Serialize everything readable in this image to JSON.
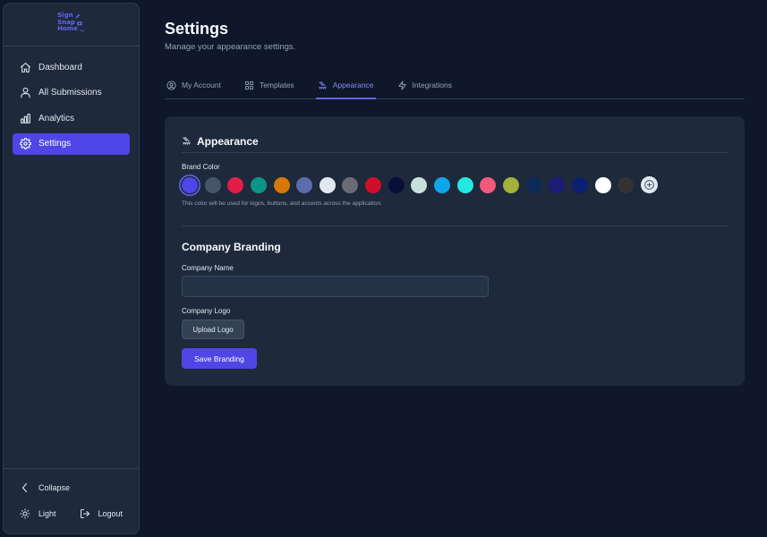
{
  "logo": {
    "line1": "Sign",
    "line2": "Snap",
    "line3": "Home"
  },
  "sidebar": {
    "items": [
      {
        "label": "Dashboard",
        "icon": "home-icon"
      },
      {
        "label": "All Submissions",
        "icon": "user-icon"
      },
      {
        "label": "Analytics",
        "icon": "bar-chart-icon"
      },
      {
        "label": "Settings",
        "icon": "gear-icon",
        "active": true
      }
    ],
    "collapse_label": "Collapse",
    "theme_label": "Light",
    "logout_label": "Logout"
  },
  "page": {
    "title": "Settings",
    "subtitle": "Manage your appearance settings."
  },
  "tabs": [
    {
      "label": "My Account",
      "icon": "user-circle-icon"
    },
    {
      "label": "Templates",
      "icon": "grid-icon"
    },
    {
      "label": "Appearance",
      "icon": "paint-roller-icon",
      "active": true
    },
    {
      "label": "Integrations",
      "icon": "lightning-icon"
    }
  ],
  "appearance": {
    "section_title": "Appearance",
    "brand_color_label": "Brand Color",
    "colors": [
      "#4f46e5",
      "#475569",
      "#e11d48",
      "#0d9488",
      "#d97706",
      "#5b6dad",
      "#e2e8f0",
      "#6b6b76",
      "#d00e28",
      "#0a0e3a",
      "#c8e0dc",
      "#0ea5e9",
      "#22e8e0",
      "#f25a7a",
      "#a3b03a",
      "#0c2a55",
      "#1e1a78",
      "#0d1f72",
      "#ffffff",
      "#333333"
    ],
    "selected_color": "#4f46e5",
    "hint": "This color will be used for logos, buttons, and accents across the application."
  },
  "branding": {
    "section_title": "Company Branding",
    "company_name_label": "Company Name",
    "company_name_value": "",
    "company_name_placeholder": "",
    "company_logo_label": "Company Logo",
    "upload_label": "Upload Logo",
    "save_label": "Save Branding"
  }
}
